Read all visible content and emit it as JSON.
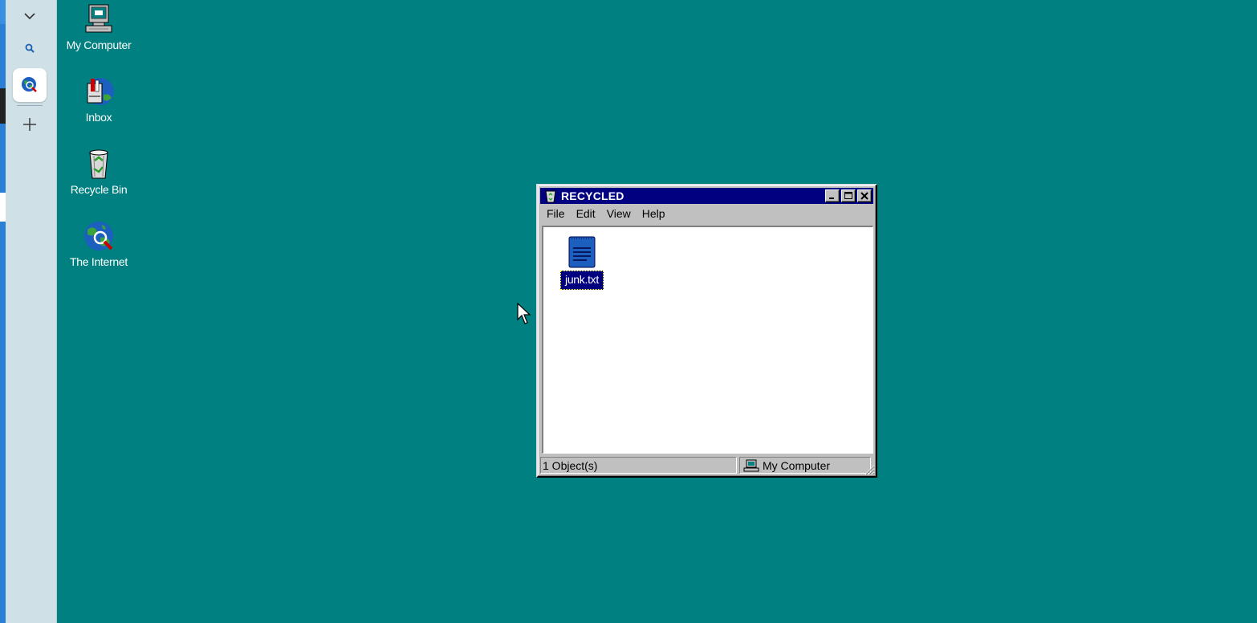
{
  "colors": {
    "desktop": "#008080",
    "titlebar": "#000080",
    "window_face": "#c0c0c0",
    "sidebar": "#cfe0e6"
  },
  "sidebar": {
    "collapse_icon": "chevron-down-icon",
    "search_icon": "search-icon",
    "active_app_icon": "internet-globe-icon",
    "add_icon": "plus-icon"
  },
  "desktop_icons": [
    {
      "label": "My Computer",
      "icon": "computer-icon"
    },
    {
      "label": "Inbox",
      "icon": "inbox-icon"
    },
    {
      "label": "Recycle Bin",
      "icon": "recycle-bin-icon"
    },
    {
      "label": "The Internet",
      "icon": "internet-globe-icon"
    }
  ],
  "window": {
    "title": "RECYCLED",
    "controls": {
      "minimize": "_",
      "maximize": "□",
      "close": "×"
    },
    "menu": [
      "File",
      "Edit",
      "View",
      "Help"
    ],
    "files": [
      {
        "name": "junk.txt",
        "icon": "text-file-icon",
        "selected": true
      }
    ],
    "status": {
      "count": "1 Object(s)",
      "location": "My Computer"
    }
  }
}
